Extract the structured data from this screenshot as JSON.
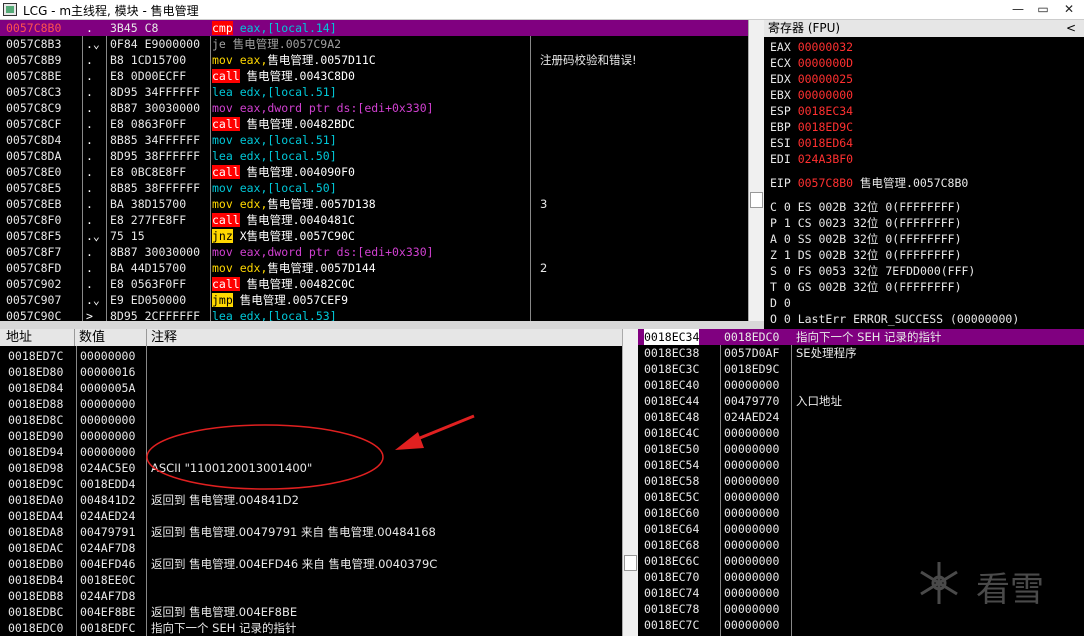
{
  "window": {
    "title": "LCG - m主线程, 模块 - 售电管理"
  },
  "cpu": {
    "rows": [
      {
        "addr": "0057C8B0",
        "mark": ".",
        "bytes": "3B45 C8",
        "dis": [
          {
            "t": "cmp",
            "c": "hl-red"
          },
          {
            "t": " eax,[local.14]",
            "c": "t-cyan"
          }
        ],
        "cmt": "",
        "sel": true
      },
      {
        "addr": "0057C8B3",
        "mark": ".⌄",
        "bytes": "0F84 E9000000",
        "dis": [
          {
            "t": "je 售电管理.0057C9A2",
            "c": "t-gray"
          }
        ],
        "cmt": ""
      },
      {
        "addr": "0057C8B9",
        "mark": ".",
        "bytes": "B8 1CD15700",
        "dis": [
          {
            "t": "mov eax,",
            "c": "t-yel"
          },
          {
            "t": "售电管理.0057D11C",
            "c": "t-white"
          }
        ],
        "cmt": "注册码校验和错误!"
      },
      {
        "addr": "0057C8BE",
        "mark": ".",
        "bytes": "E8 0D00ECFF",
        "dis": [
          {
            "t": "call",
            "c": "hl-red"
          },
          {
            "t": " 售电管理.0043C8D0",
            "c": "t-white"
          }
        ],
        "cmt": ""
      },
      {
        "addr": "0057C8C3",
        "mark": ".",
        "bytes": "8D95 34FFFFFF",
        "dis": [
          {
            "t": "lea edx,[local.51]",
            "c": "t-cyan"
          }
        ],
        "cmt": ""
      },
      {
        "addr": "0057C8C9",
        "mark": ".",
        "bytes": "8B87 30030000",
        "dis": [
          {
            "t": "mov eax,dword ptr ds:[edi+0x330]",
            "c": "t-mag"
          }
        ],
        "cmt": ""
      },
      {
        "addr": "0057C8CF",
        "mark": ".",
        "bytes": "E8 0863F0FF",
        "dis": [
          {
            "t": "call",
            "c": "hl-red"
          },
          {
            "t": " 售电管理.00482BDC",
            "c": "t-white"
          }
        ],
        "cmt": ""
      },
      {
        "addr": "0057C8D4",
        "mark": ".",
        "bytes": "8B85 34FFFFFF",
        "dis": [
          {
            "t": "mov eax,[local.51]",
            "c": "t-cyan"
          }
        ],
        "cmt": ""
      },
      {
        "addr": "0057C8DA",
        "mark": ".",
        "bytes": "8D95 38FFFFFF",
        "dis": [
          {
            "t": "lea edx,[local.50]",
            "c": "t-cyan"
          }
        ],
        "cmt": ""
      },
      {
        "addr": "0057C8E0",
        "mark": ".",
        "bytes": "E8 0BC8E8FF",
        "dis": [
          {
            "t": "call",
            "c": "hl-red"
          },
          {
            "t": " 售电管理.004090F0",
            "c": "t-white"
          }
        ],
        "cmt": ""
      },
      {
        "addr": "0057C8E5",
        "mark": ".",
        "bytes": "8B85 38FFFFFF",
        "dis": [
          {
            "t": "mov eax,[local.50]",
            "c": "t-cyan"
          }
        ],
        "cmt": ""
      },
      {
        "addr": "0057C8EB",
        "mark": ".",
        "bytes": "BA 38D15700",
        "dis": [
          {
            "t": "mov edx,",
            "c": "t-yel"
          },
          {
            "t": "售电管理.0057D138",
            "c": "t-white"
          }
        ],
        "cmt": "3"
      },
      {
        "addr": "0057C8F0",
        "mark": ".",
        "bytes": "E8 277FE8FF",
        "dis": [
          {
            "t": "call",
            "c": "hl-red"
          },
          {
            "t": " 售电管理.0040481C",
            "c": "t-white"
          }
        ],
        "cmt": ""
      },
      {
        "addr": "0057C8F5",
        "mark": ".⌄",
        "bytes": "75 15",
        "dis": [
          {
            "t": "jnz",
            "c": "hl-yel"
          },
          {
            "t": " X售电管理.0057C90C",
            "c": "t-white"
          }
        ],
        "cmt": ""
      },
      {
        "addr": "0057C8F7",
        "mark": ".",
        "bytes": "8B87 30030000",
        "dis": [
          {
            "t": "mov eax,dword ptr ds:[edi+0x330]",
            "c": "t-mag"
          }
        ],
        "cmt": ""
      },
      {
        "addr": "0057C8FD",
        "mark": ".",
        "bytes": "BA 44D15700",
        "dis": [
          {
            "t": "mov edx,",
            "c": "t-yel"
          },
          {
            "t": "售电管理.0057D144",
            "c": "t-white"
          }
        ],
        "cmt": "2"
      },
      {
        "addr": "0057C902",
        "mark": ".",
        "bytes": "E8 0563F0FF",
        "dis": [
          {
            "t": "call",
            "c": "hl-red"
          },
          {
            "t": " 售电管理.00482C0C",
            "c": "t-white"
          }
        ],
        "cmt": ""
      },
      {
        "addr": "0057C907",
        "mark": ".⌄",
        "bytes": "E9 ED050000",
        "dis": [
          {
            "t": "jmp",
            "c": "hl-yel"
          },
          {
            "t": " 售电管理.0057CEF9",
            "c": "t-white"
          }
        ],
        "cmt": ""
      },
      {
        "addr": "0057C90C",
        "mark": ">",
        "bytes": "8D95 2CFFFFFF",
        "dis": [
          {
            "t": "lea edx,[local.53]",
            "c": "t-cyan"
          }
        ],
        "cmt": ""
      }
    ]
  },
  "registers": {
    "header": "寄存器 (FPU)",
    "chevron": "<",
    "gp": [
      {
        "name": "EAX",
        "val": "00000032"
      },
      {
        "name": "ECX",
        "val": "0000000D"
      },
      {
        "name": "EDX",
        "val": "00000025"
      },
      {
        "name": "EBX",
        "val": "00000000"
      },
      {
        "name": "ESP",
        "val": "0018EC34"
      },
      {
        "name": "EBP",
        "val": "0018ED9C"
      },
      {
        "name": "ESI",
        "val": "0018ED64"
      },
      {
        "name": "EDI",
        "val": "024A3BF0"
      }
    ],
    "eip": {
      "name": "EIP",
      "val": "0057C8B0",
      "note": "售电管理.0057C8B0"
    },
    "flags": [
      "C 0  ES 002B 32位 0(FFFFFFFF)",
      "P 1  CS 0023 32位 0(FFFFFFFF)",
      "A 0  SS 002B 32位 0(FFFFFFFF)",
      "Z 1  DS 002B 32位 0(FFFFFFFF)",
      "S 0  FS 0053 32位 7EFDD000(FFF)",
      "T 0  GS 002B 32位 0(FFFFFFFF)",
      "D 0",
      "O 0  LastErr ERROR_SUCCESS (00000000)"
    ]
  },
  "dump": {
    "headers": {
      "addr": "地址",
      "value": "数值",
      "comment": "注释"
    },
    "rows": [
      {
        "addr": "0018ED7C",
        "val": "00000000",
        "cmt": ""
      },
      {
        "addr": "0018ED80",
        "val": "00000016",
        "cmt": ""
      },
      {
        "addr": "0018ED84",
        "val": "0000005A",
        "cmt": ""
      },
      {
        "addr": "0018ED88",
        "val": "00000000",
        "cmt": ""
      },
      {
        "addr": "0018ED8C",
        "val": "00000000",
        "cmt": ""
      },
      {
        "addr": "0018ED90",
        "val": "00000000",
        "cmt": ""
      },
      {
        "addr": "0018ED94",
        "val": "00000000",
        "cmt": ""
      },
      {
        "addr": "0018ED98",
        "val": "024AC5E0",
        "cmt": "ASCII \"1100120013001400\""
      },
      {
        "addr": "0018ED9C",
        "val": "0018EDD4",
        "cmt": ""
      },
      {
        "addr": "0018EDA0",
        "val": "004841D2",
        "cmt": "返回到 售电管理.004841D2"
      },
      {
        "addr": "0018EDA4",
        "val": "024AED24",
        "cmt": ""
      },
      {
        "addr": "0018EDA8",
        "val": "00479791",
        "cmt": "返回到 售电管理.00479791 来自 售电管理.00484168"
      },
      {
        "addr": "0018EDAC",
        "val": "024AF7D8",
        "cmt": ""
      },
      {
        "addr": "0018EDB0",
        "val": "004EFD46",
        "cmt": "返回到 售电管理.004EFD46 来自 售电管理.0040379C"
      },
      {
        "addr": "0018EDB4",
        "val": "0018EE0C",
        "cmt": ""
      },
      {
        "addr": "0018EDB8",
        "val": "024AF7D8",
        "cmt": ""
      },
      {
        "addr": "0018EDBC",
        "val": "004EF8BE",
        "cmt": "返回到 售电管理.004EF8BE"
      },
      {
        "addr": "0018EDC0",
        "val": "0018EDFC",
        "cmt": "指向下一个 SEH 记录的指针"
      }
    ]
  },
  "stack": {
    "rows": [
      {
        "addr": "0018EC34",
        "val": "0018EDC0",
        "cmt": "指向下一个 SEH 记录的指针",
        "top": true
      },
      {
        "addr": "0018EC38",
        "val": "0057D0AF",
        "cmt": "SE处理程序"
      },
      {
        "addr": "0018EC3C",
        "val": "0018ED9C",
        "cmt": ""
      },
      {
        "addr": "0018EC40",
        "val": "00000000",
        "cmt": ""
      },
      {
        "addr": "0018EC44",
        "val": "00479770",
        "cmt": "入口地址"
      },
      {
        "addr": "0018EC48",
        "val": "024AED24",
        "cmt": ""
      },
      {
        "addr": "0018EC4C",
        "val": "00000000",
        "cmt": ""
      },
      {
        "addr": "0018EC50",
        "val": "00000000",
        "cmt": ""
      },
      {
        "addr": "0018EC54",
        "val": "00000000",
        "cmt": ""
      },
      {
        "addr": "0018EC58",
        "val": "00000000",
        "cmt": ""
      },
      {
        "addr": "0018EC5C",
        "val": "00000000",
        "cmt": ""
      },
      {
        "addr": "0018EC60",
        "val": "00000000",
        "cmt": ""
      },
      {
        "addr": "0018EC64",
        "val": "00000000",
        "cmt": ""
      },
      {
        "addr": "0018EC68",
        "val": "00000000",
        "cmt": ""
      },
      {
        "addr": "0018EC6C",
        "val": "00000000",
        "cmt": ""
      },
      {
        "addr": "0018EC70",
        "val": "00000000",
        "cmt": ""
      },
      {
        "addr": "0018EC74",
        "val": "00000000",
        "cmt": ""
      },
      {
        "addr": "0018EC78",
        "val": "00000000",
        "cmt": ""
      },
      {
        "addr": "0018EC7C",
        "val": "00000000",
        "cmt": ""
      }
    ]
  },
  "watermark": {
    "text": "看雪"
  },
  "colors": {
    "selection": "#800080",
    "call_bg": "#ff0000",
    "jump_bg": "#ffd800",
    "reg_value": "#ff3030",
    "annotation": "#e02020"
  }
}
